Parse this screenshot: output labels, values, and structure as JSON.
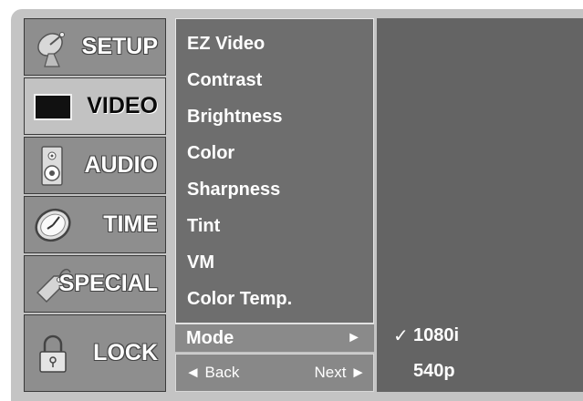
{
  "sidebar": {
    "items": [
      {
        "label": "SETUP",
        "icon": "satellite-dish-icon"
      },
      {
        "label": "VIDEO",
        "icon": "tv-screen-icon"
      },
      {
        "label": "AUDIO",
        "icon": "speaker-icon"
      },
      {
        "label": "TIME",
        "icon": "clock-icon"
      },
      {
        "label": "SPECIAL",
        "icon": "tag-icon"
      },
      {
        "label": "LOCK",
        "icon": "padlock-icon"
      }
    ],
    "active": "VIDEO"
  },
  "submenu": {
    "items": [
      "EZ Video",
      "Contrast",
      "Brightness",
      "Color",
      "Sharpness",
      "Tint",
      "VM",
      "Color Temp."
    ],
    "selected": {
      "label": "Mode",
      "arrow": "►"
    }
  },
  "nav": {
    "back": "◄ Back",
    "next": "Next ►"
  },
  "options": {
    "items": [
      {
        "label": "1080i",
        "checked": true,
        "check": "✓"
      },
      {
        "label": "540p",
        "checked": false,
        "check": ""
      }
    ]
  },
  "colors": {
    "frame": "#c4c4c4",
    "panel": "#646464",
    "submenu": "#6e6e6e",
    "sidebar_item": "#8e8e8e",
    "sidebar_active": "#c2c2c2"
  }
}
